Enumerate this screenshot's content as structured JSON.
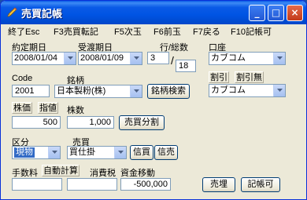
{
  "window": {
    "title": "売買記帳",
    "icon": "pencil-icon",
    "controls": {
      "minimize": "_",
      "maximize": "□",
      "close": "×"
    }
  },
  "menu": [
    {
      "label": "終了Esc"
    },
    {
      "label": "F3売買転記"
    },
    {
      "label": "F5次玉"
    },
    {
      "label": "F6前玉"
    },
    {
      "label": "F7戻る"
    },
    {
      "label": "F10記帳可"
    }
  ],
  "form": {
    "contract_date": {
      "label": "約定期日",
      "value": "2008/01/04"
    },
    "settlement_date": {
      "label": "受渡期日",
      "value": "2008/01/09"
    },
    "row_total": {
      "label": "行/総数",
      "row": "3",
      "separator": "/",
      "total": "18"
    },
    "account": {
      "label": "口座",
      "value": "カブコム"
    },
    "code": {
      "label": "Code",
      "value": "2001"
    },
    "stock": {
      "label": "銘柄",
      "value": "日本製粉(株)",
      "search_button": "銘柄検索"
    },
    "discount": {
      "label_on": "割引",
      "label_off": "割引無",
      "value": "カブコム"
    },
    "price": {
      "label_stock": "株価",
      "label_limit": "指値",
      "value": "500"
    },
    "quantity": {
      "label": "株数",
      "value": "1,000",
      "split_button": "売買分割"
    },
    "category": {
      "label": "区分",
      "value": "現物"
    },
    "trade": {
      "label": "売買",
      "value": "買仕掛",
      "credit_buy_button": "信買",
      "credit_sell_button": "信売"
    },
    "commission": {
      "label": "手数料",
      "value": ""
    },
    "auto_calc_button": "自動計算",
    "consumption_tax": {
      "label": "消費税",
      "value": ""
    },
    "fund_transfer": {
      "label": "資金移動",
      "value": "-500,000"
    },
    "trade_button": "売埋",
    "record_button": "記帳可"
  }
}
